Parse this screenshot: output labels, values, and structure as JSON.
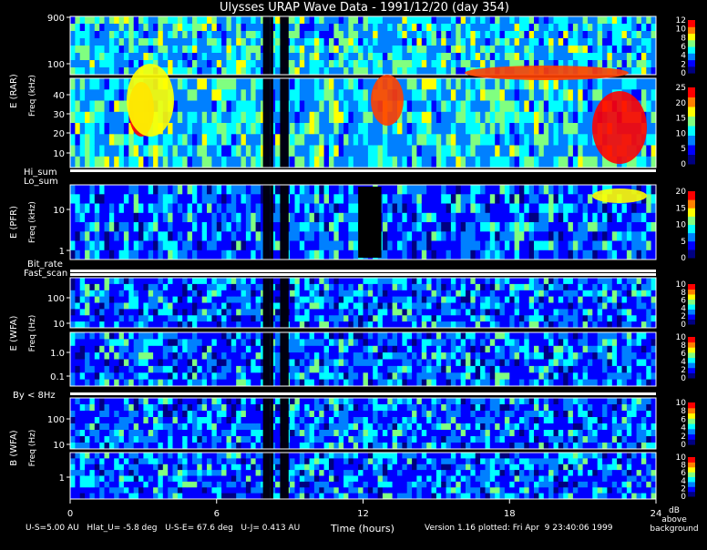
{
  "chart_data": {
    "type": "heatmap",
    "title": "Ulysses URAP Wave Data - 1991/12/20 (day 354)",
    "xlabel": "Time (hours)",
    "x_ticks": [
      "0",
      "6",
      "12",
      "18",
      "24"
    ],
    "xlim": [
      0,
      24
    ],
    "panels": [
      {
        "id": "rar_high",
        "group_label": "E (RAR)",
        "freq_label": "Freq (kHz)",
        "y_ticks": [
          "100",
          "900"
        ],
        "cbar_ticks": [
          "0",
          "2",
          "4",
          "6",
          "8",
          "10",
          "12"
        ]
      },
      {
        "id": "rar_low",
        "group_label": "E (RAR)",
        "freq_label": "Freq (kHz)",
        "y_ticks": [
          "10",
          "20",
          "30",
          "40"
        ],
        "cbar_ticks": [
          "0",
          "5",
          "10",
          "15",
          "20",
          "25"
        ]
      },
      {
        "id": "pfr",
        "group_label": "E (PFR)",
        "freq_label": "Freq (kHz)",
        "y_ticks": [
          "1",
          "10"
        ],
        "cbar_ticks": [
          "0",
          "5",
          "10",
          "15",
          "20"
        ]
      },
      {
        "id": "wfa_e_high",
        "group_label": "E (WFA)",
        "freq_label": "Freq (Hz)",
        "y_ticks": [
          "10",
          "100"
        ],
        "cbar_ticks": [
          "0",
          "2",
          "4",
          "6",
          "8",
          "10"
        ]
      },
      {
        "id": "wfa_e_low",
        "group_label": "E (WFA)",
        "freq_label": "Freq (Hz)",
        "y_ticks": [
          "0.1",
          "1.0"
        ],
        "cbar_ticks": [
          "0",
          "2",
          "4",
          "6",
          "8",
          "10"
        ]
      },
      {
        "id": "wfa_b_high",
        "group_label": "B (WFA)",
        "freq_label": "Freq (Hz)",
        "y_ticks": [
          "10",
          "100"
        ],
        "cbar_ticks": [
          "0",
          "2",
          "4",
          "6",
          "8",
          "10"
        ]
      },
      {
        "id": "wfa_b_low",
        "group_label": "B (WFA)",
        "freq_label": "Freq (Hz)",
        "y_ticks": [
          "1"
        ],
        "cbar_ticks": [
          "0",
          "2",
          "4",
          "6",
          "8",
          "10"
        ]
      }
    ],
    "indicator_labels": {
      "hi_sum": "Hi_sum",
      "lo_sum": "Lo_sum",
      "bit_rate": "Bit_rate",
      "fast_scan": "Fast_scan",
      "by": "By < 8Hz"
    },
    "colorbar_unit": [
      "dB",
      "above",
      "background"
    ],
    "colormap": [
      "#000080",
      "#0000ff",
      "#0080ff",
      "#00ffff",
      "#80ff80",
      "#ffff00",
      "#ff8000",
      "#ff0000"
    ]
  },
  "footer": {
    "left": "U-S=5.00 AU   Hlat_U= -5.8 deg   U-S-E= 67.6 deg   U-J= 0.413 AU",
    "right": "Version 1.16 plotted: Fri Apr  9 23:40:06 1999"
  }
}
